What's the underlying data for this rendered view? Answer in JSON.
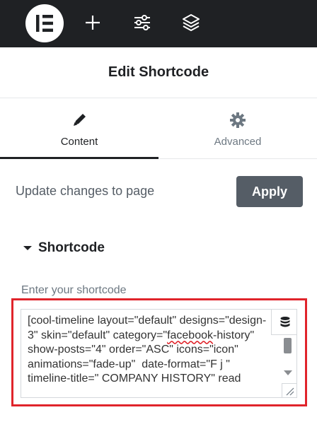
{
  "topbar": {
    "logo_icon": "elementor-logo-icon",
    "icons": [
      "plus-icon",
      "sliders-icon",
      "layers-icon"
    ]
  },
  "panel": {
    "title": "Edit Shortcode"
  },
  "tabs": [
    {
      "label": "Content",
      "icon": "pencil-icon",
      "active": true
    },
    {
      "label": "Advanced",
      "icon": "gear-icon",
      "active": false
    }
  ],
  "update": {
    "text": "Update changes to page",
    "apply_label": "Apply"
  },
  "section": {
    "title": "Shortcode"
  },
  "shortcode_field": {
    "label": "Enter your shortcode",
    "value_before": "[cool-timeline layout=\"default\" designs=\"design-3\" skin=\"default\" category=\"",
    "value_misspelled": "facebook",
    "value_after": "-history\" show-posts=\"4\" order=\"ASC\" icons=\"icon\" animations=\"fade-up\"  date-format=\"F j \" timeline-title=\" COMPANY HISTORY\" read",
    "dynamic_icon": "database-icon"
  },
  "colors": {
    "topbar": "#1f2124",
    "apply_button": "#555d66",
    "highlight": "#e0242b"
  }
}
